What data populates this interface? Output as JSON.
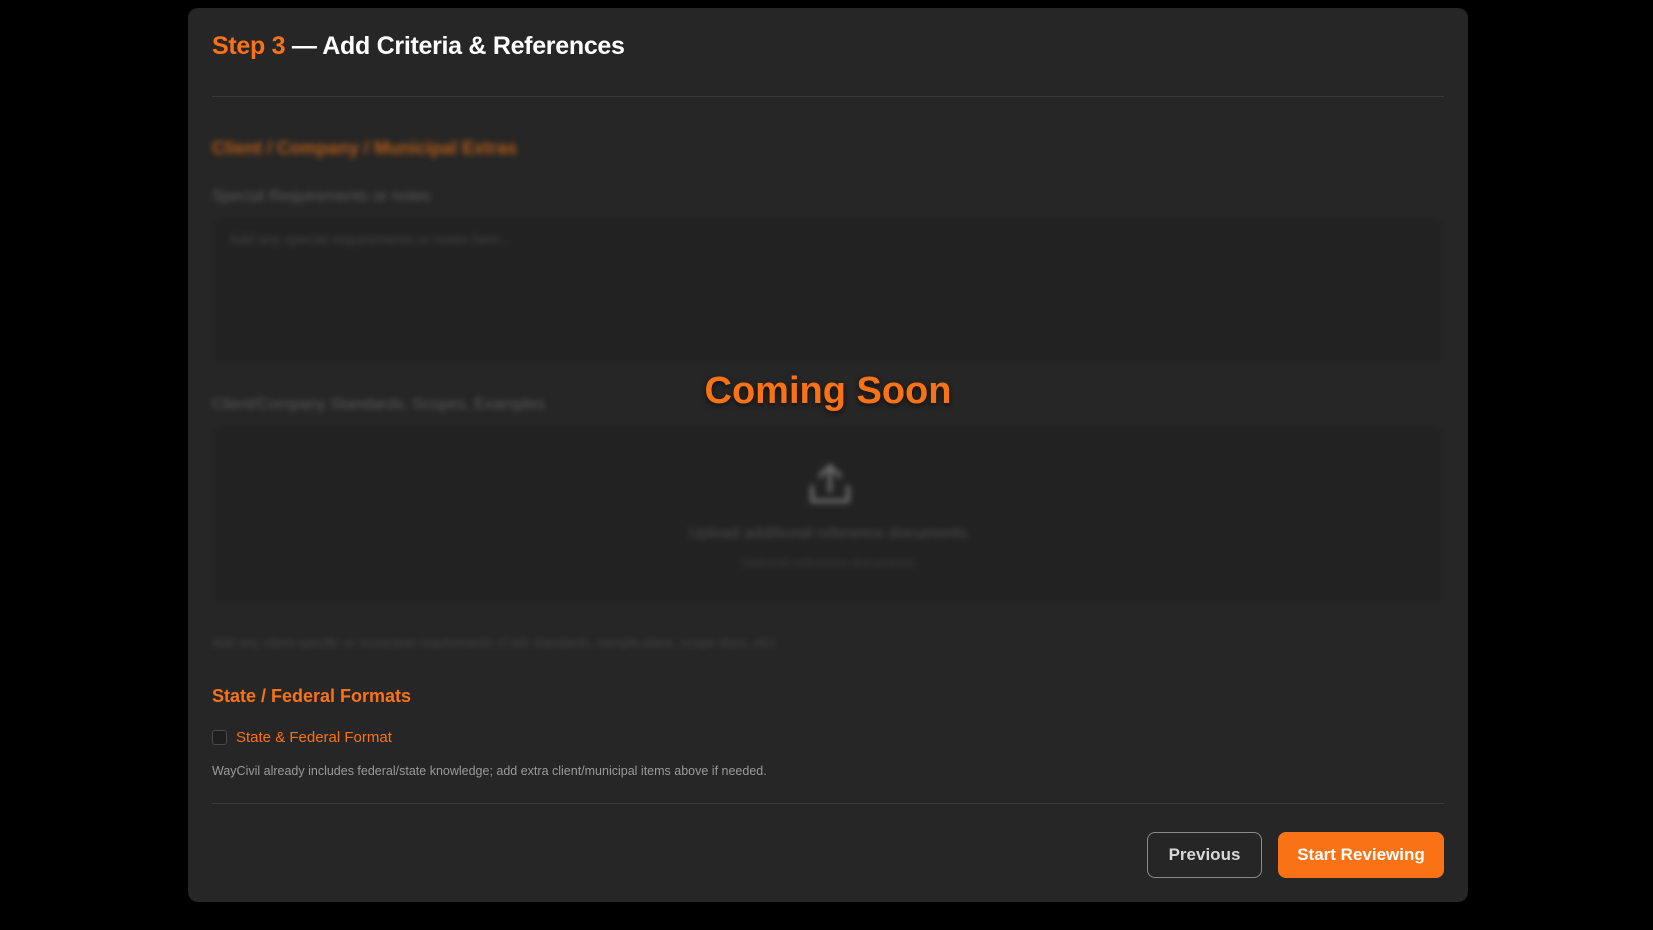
{
  "step": {
    "label": "Step 3",
    "title": " — Add Criteria & References"
  },
  "client_section": {
    "heading": "Client / Company / Municipal Extras",
    "notes_label": "Special Requirements or notes",
    "notes_placeholder": "Add any special requirements or notes here...",
    "standards_label": "Client/Company Standards, Scopes, Examples",
    "upload_title": "Upload additional reference documents",
    "upload_subtitle": "Optional reference documents",
    "hint": "Add any client specific or municipal requirements (CAD standards, sample plans, scope docs, etc)"
  },
  "overlay": {
    "text": "Coming Soon"
  },
  "federal_section": {
    "heading": "State / Federal Formats",
    "checkbox_label": "State & Federal Format",
    "checkbox_checked": false,
    "hint": "WayCivil already includes federal/state knowledge; add extra client/municipal items above if needed."
  },
  "actions": {
    "previous": "Previous",
    "start": "Start Reviewing"
  },
  "colors": {
    "accent": "#f97316",
    "card": "#262626",
    "background": "#000000"
  },
  "icons": {
    "upload": "upload-icon"
  }
}
